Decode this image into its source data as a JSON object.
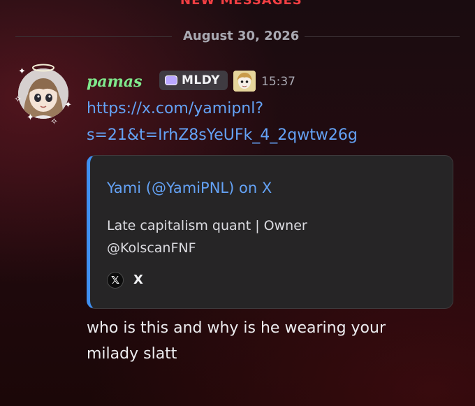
{
  "banner": {
    "new_messages": "NEW MESSAGES"
  },
  "date_divider": {
    "label": "August 30, 2026"
  },
  "message": {
    "author": "pamas",
    "server_tag": "MLDY",
    "timestamp": "15:37",
    "link_line1": "https://x.com/yamipnl?",
    "link_line2": "s=21&t=IrhZ8sYeUFk_4_2qwtw26g",
    "embed": {
      "title": "Yami (@YamiPNL) on X",
      "description_line1": "Late capitalism quant | Owner",
      "description_line2": "@KolscanFNF",
      "provider_icon": "x-logo-icon",
      "provider": "X",
      "accent_color": "#3f8ff0"
    },
    "text_line1": "who is this and why is he wearing your",
    "text_line2": "milady slatt"
  },
  "colors": {
    "username": "#7fe98c",
    "link": "#64a2f5",
    "new_messages": "#f23f43"
  }
}
